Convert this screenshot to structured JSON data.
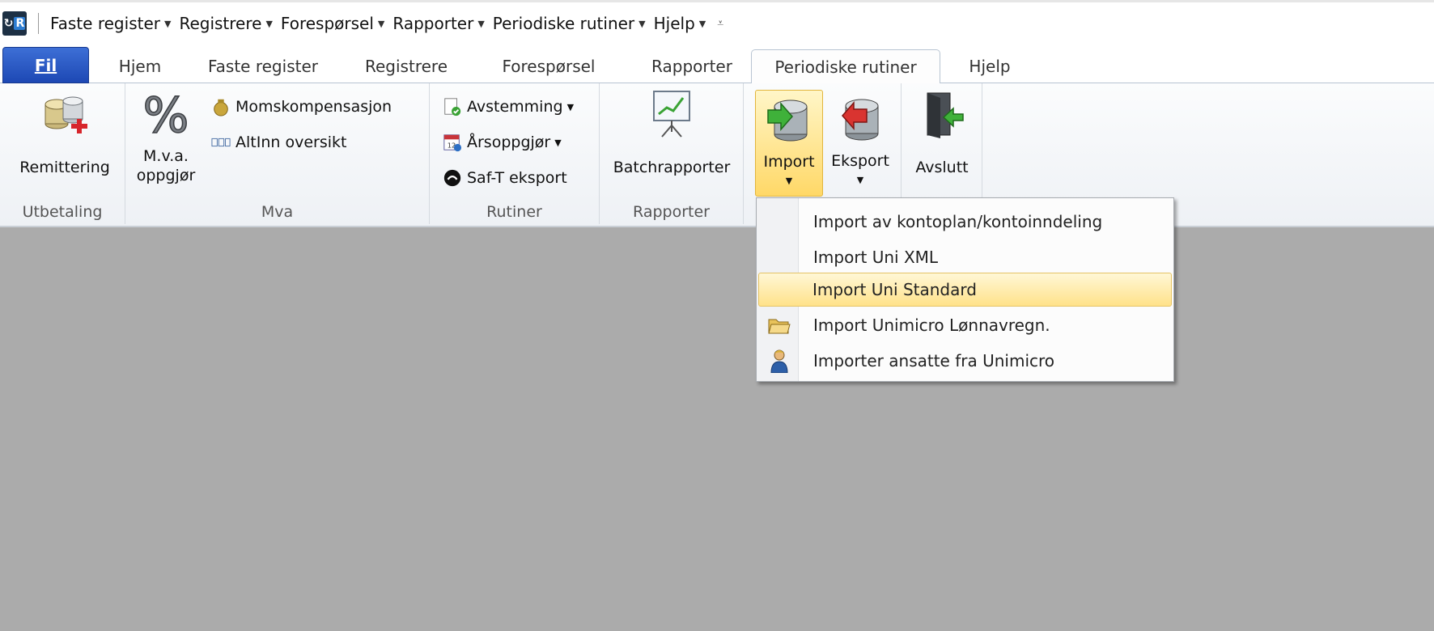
{
  "quick_access": {
    "logo": "R",
    "items": [
      "Faste register",
      "Registrere",
      "Forespørsel",
      "Rapporter",
      "Periodiske rutiner",
      "Hjelp"
    ]
  },
  "tabs": [
    "Fil",
    "Hjem",
    "Faste register",
    "Registrere",
    "Forespørsel",
    "Rapporter",
    "Periodiske rutiner",
    "Hjelp"
  ],
  "active_tab": "Periodiske rutiner",
  "ribbon": {
    "utbetaling": {
      "label": "Utbetaling",
      "remittering": "Remittering"
    },
    "mva": {
      "label": "Mva",
      "mva_line1": "M.v.a.",
      "mva_line2": "oppgjør",
      "momskomp": "Momskompensasjon",
      "altinn": "AltInn oversikt"
    },
    "rutiner": {
      "label": "Rutiner",
      "avstemming": "Avstemming",
      "arsoppgjor": "Årsoppgjør",
      "saft": "Saf-T eksport"
    },
    "rapporter": {
      "label": "Rapporter",
      "batch": "Batchrapporter"
    },
    "importexport": {
      "import": "Import",
      "eksport": "Eksport"
    },
    "avslutt": {
      "label": "Avslutt"
    }
  },
  "import_menu": {
    "items": [
      "Import av kontoplan/kontoinndeling",
      "Import Uni XML",
      "Import Uni Standard",
      "Import Unimicro Lønnavregn.",
      "Importer ansatte fra Unimicro"
    ],
    "highlighted": "Import Uni Standard"
  },
  "colors": {
    "accent_file": "#2b5cc7",
    "highlight": "#ffe28a",
    "workspace": "#ababab"
  }
}
